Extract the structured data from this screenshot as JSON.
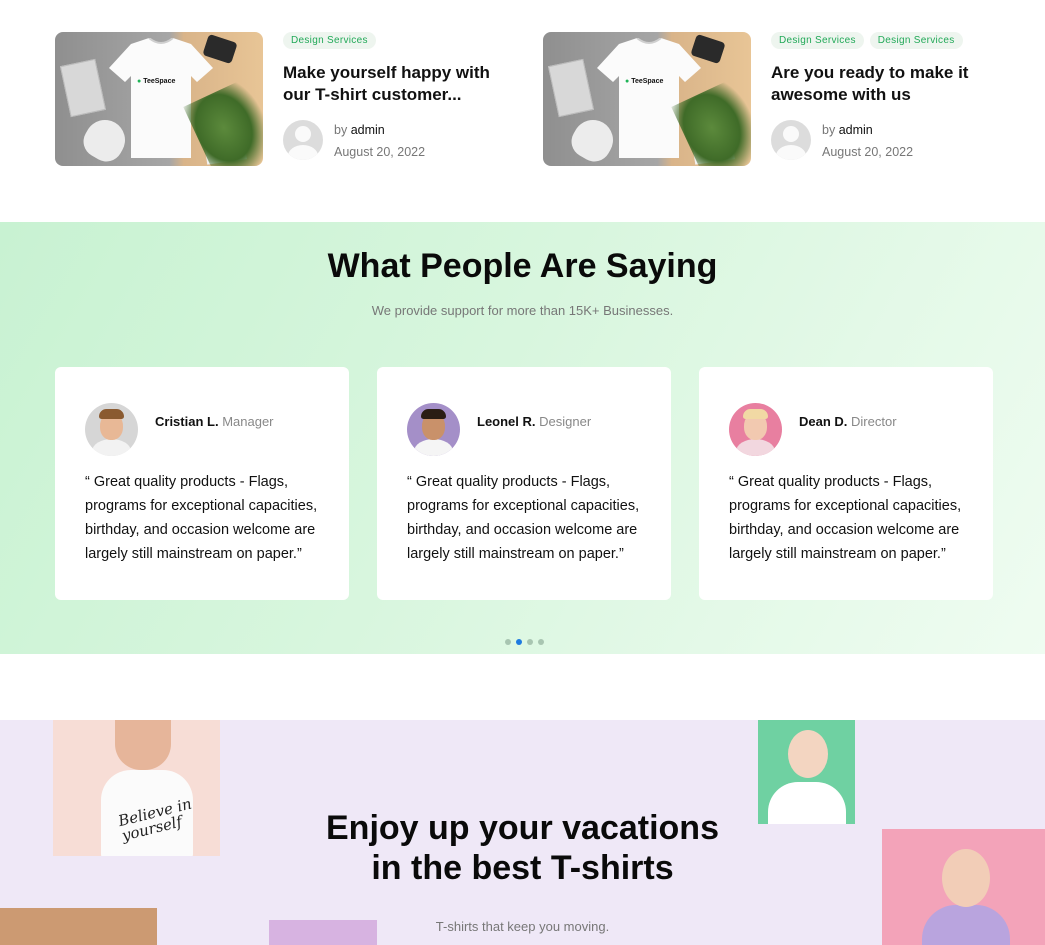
{
  "posts": [
    {
      "tags": [
        "Design Services"
      ],
      "title": "Make yourself happy with our T-shirt customer...",
      "by_label": "by",
      "author": "admin",
      "date": "August 20, 2022",
      "thumb_logo": "TeeSpace"
    },
    {
      "tags": [
        "Design Services",
        "Design Services"
      ],
      "title": "Are you ready to make it awesome with us",
      "by_label": "by",
      "author": "admin",
      "date": "August 20, 2022",
      "thumb_logo": "TeeSpace"
    }
  ],
  "testimonials": {
    "title": "What People Are Saying",
    "subtitle": "We provide support for more than 15K+ Businesses.",
    "cards": [
      {
        "name": "Cristian L.",
        "role": "Manager",
        "quote": "“ Great quality products - Flags, programs for exceptional capacities, birthday, and occasion welcome are largely still mainstream on paper.”"
      },
      {
        "name": "Leonel R.",
        "role": "Designer",
        "quote": "“ Great quality products - Flags, programs for exceptional capacities, birthday, and occasion welcome are largely still mainstream on paper.”"
      },
      {
        "name": "Dean D.",
        "role": "Director",
        "quote": "“ Great quality products - Flags, programs for exceptional capacities, birthday, and occasion welcome are largely still mainstream on paper.”"
      }
    ],
    "pagination": {
      "total": 4,
      "active": 2
    }
  },
  "vacations": {
    "title_line1": "Enjoy up your vacations",
    "title_line2": "in the best T-shirts",
    "subtitle": "T-shirts that keep you moving.",
    "shirt_print": "Believe in yourself"
  },
  "colors": {
    "accent_green": "#22a958",
    "tag_bg": "#eef5ef",
    "testimonial_bg": "#d8f6de",
    "vacation_bg": "#efe8f7",
    "active_dot": "#1e7be0"
  }
}
